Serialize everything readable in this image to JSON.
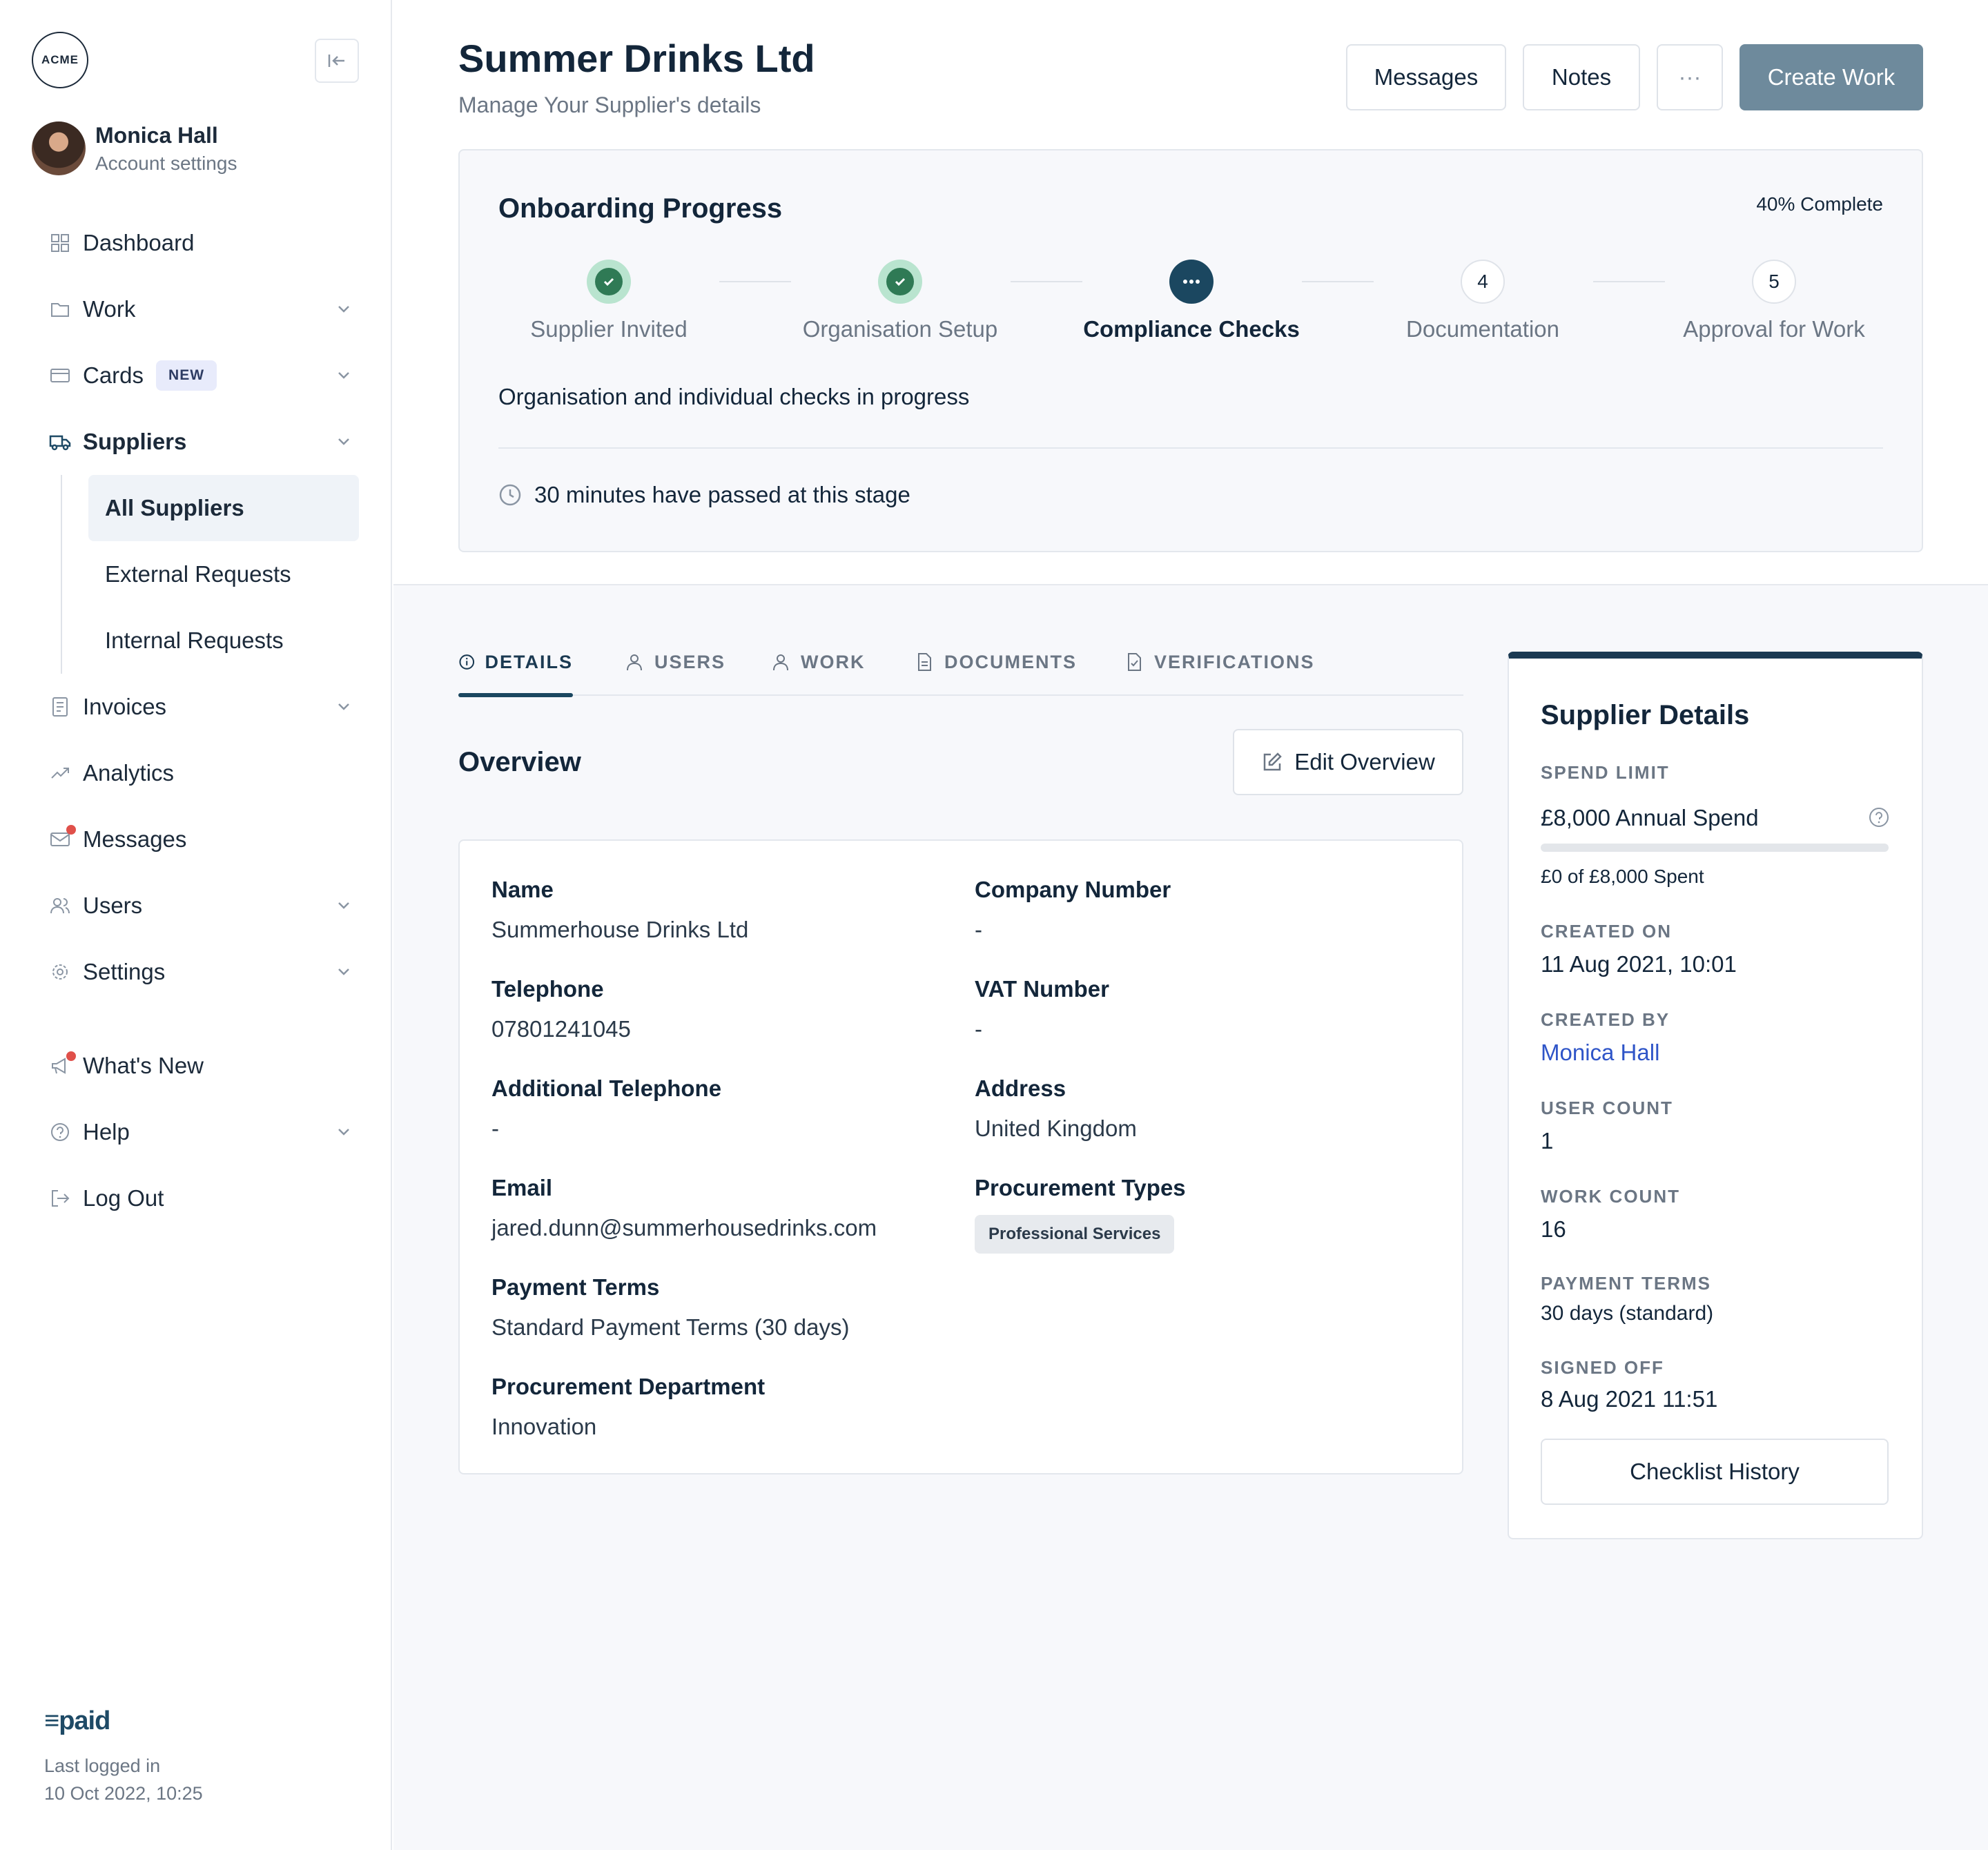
{
  "brand": {
    "logo_text": "ACME",
    "footer_logo": "paid"
  },
  "user": {
    "name": "Monica Hall",
    "subtitle": "Account settings"
  },
  "sidebar": {
    "items": [
      {
        "label": "Dashboard",
        "icon": "grid-icon"
      },
      {
        "label": "Work",
        "icon": "folder-icon"
      },
      {
        "label": "Cards",
        "icon": "card-icon",
        "badge": "NEW"
      },
      {
        "label": "Suppliers",
        "icon": "truck-icon"
      },
      {
        "label": "Invoices",
        "icon": "invoice-icon"
      },
      {
        "label": "Analytics",
        "icon": "trend-icon"
      },
      {
        "label": "Messages",
        "icon": "mail-icon"
      },
      {
        "label": "Users",
        "icon": "users-icon"
      },
      {
        "label": "Settings",
        "icon": "gear-icon"
      },
      {
        "label": "What's New",
        "icon": "megaphone-icon"
      },
      {
        "label": "Help",
        "icon": "help-icon"
      },
      {
        "label": "Log Out",
        "icon": "logout-icon"
      }
    ],
    "suppliers_sub": [
      "All Suppliers",
      "External Requests",
      "Internal Requests"
    ],
    "last_login_label": "Last logged in",
    "last_login_value": "10 Oct 2022, 10:25"
  },
  "header": {
    "title": "Summer Drinks Ltd",
    "subtitle": "Manage Your Supplier's details",
    "buttons": {
      "messages": "Messages",
      "notes": "Notes",
      "more": "···",
      "create": "Create Work"
    }
  },
  "onboarding": {
    "title": "Onboarding Progress",
    "percent": "40% Complete",
    "steps": [
      {
        "label": "Supplier Invited",
        "state": "done"
      },
      {
        "label": "Organisation Setup",
        "state": "done"
      },
      {
        "label": "Compliance Checks",
        "state": "current"
      },
      {
        "label": "Documentation",
        "state": "todo",
        "number": "4"
      },
      {
        "label": "Approval for Work",
        "state": "todo",
        "number": "5"
      }
    ],
    "message": "Organisation and individual checks in progress",
    "time_passed": "30 minutes have passed at this stage"
  },
  "tabs": [
    "DETAILS",
    "USERS",
    "WORK",
    "DOCUMENTS",
    "VERIFICATIONS"
  ],
  "overview": {
    "title": "Overview",
    "edit_label": "Edit Overview",
    "fields": {
      "name": {
        "label": "Name",
        "value": "Summerhouse Drinks Ltd"
      },
      "company_number": {
        "label": "Company Number",
        "value": "-"
      },
      "telephone": {
        "label": "Telephone",
        "value": "07801241045"
      },
      "vat_number": {
        "label": "VAT Number",
        "value": "-"
      },
      "additional_telephone": {
        "label": "Additional Telephone",
        "value": "-"
      },
      "address": {
        "label": "Address",
        "value": "United Kingdom"
      },
      "email": {
        "label": "Email",
        "value": "jared.dunn@summerhousedrinks.com"
      },
      "procurement_types": {
        "label": "Procurement Types",
        "value": "Professional Services"
      },
      "payment_terms": {
        "label": "Payment Terms",
        "value": "Standard Payment Terms (30 days)"
      },
      "procurement_department": {
        "label": "Procurement Department",
        "value": "Innovation"
      }
    }
  },
  "supplier_details": {
    "title": "Supplier Details",
    "spend_limit_label": "SPEND LIMIT",
    "spend_limit_value": "£8,000 Annual Spend",
    "spent_fraction": 0,
    "spent_text": "£0 of £8,000 Spent",
    "created_on_label": "CREATED ON",
    "created_on_value": "11 Aug 2021, 10:01",
    "created_by_label": "CREATED BY",
    "created_by_value": "Monica Hall",
    "user_count_label": "USER COUNT",
    "user_count_value": "1",
    "work_count_label": "WORK COUNT",
    "work_count_value": "16",
    "payment_terms_label": "PAYMENT TERMS",
    "payment_terms_value": "30 days (standard)",
    "signed_off_label": "SIGNED OFF",
    "signed_off_value": "8 Aug 2021 11:51",
    "checklist_label": "Checklist History"
  }
}
